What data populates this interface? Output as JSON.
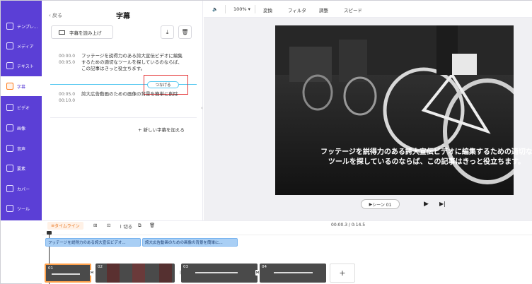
{
  "sidebar": {
    "items": [
      {
        "label": "テンプレ..."
      },
      {
        "label": "メディア"
      },
      {
        "label": "テキスト"
      },
      {
        "label": "字幕"
      },
      {
        "label": "ビデオ"
      },
      {
        "label": "画像"
      },
      {
        "label": "音声"
      },
      {
        "label": "要素"
      },
      {
        "label": "カバー"
      },
      {
        "label": "ツール"
      }
    ],
    "active_index": 3,
    "bg_color": "#5b3fd6"
  },
  "panel": {
    "back_label": "戻る",
    "title": "字幕",
    "read_button": "字幕を読み上げ",
    "subtitles": [
      {
        "start": "00:00.0",
        "end": "00:05.0",
        "text": "フッテージを説得力のある誇大宣伝ビデオに編集するための適切なツールを探しているのならば、この記事はきっと役立ちます。"
      },
      {
        "start": "00:05.0",
        "end": "00:10.0",
        "text": "誇大広告動画のための画像の背景を簡単に削除"
      }
    ],
    "join_label": "つなげる",
    "add_subtitle": "新しい字幕を加える"
  },
  "toolbar": {
    "zoom": "100%",
    "items": [
      "変換",
      "フィルタ",
      "調整",
      "スピード"
    ]
  },
  "preview": {
    "caption": "フッテージを説得力のある誇大宣伝ビデオに編集するための適切なツールを探しているのならば、この記事はきっと役立ちます。",
    "scene_label": "シーン 01"
  },
  "timeline": {
    "label": "タイムライン",
    "split_label": "切る",
    "time": "00:00.3 / 0:14.5",
    "subtitle_clips": [
      "フッテージを説得力のある誇大宣伝ビデオ...",
      "誇大広告動画のための画像の背景を簡単に..."
    ],
    "clips": [
      "01",
      "02",
      "03",
      "04"
    ]
  },
  "colors": {
    "accent": "#ff7a1a",
    "brand": "#5b3fd6",
    "highlight": "#e5383b",
    "subtitle_clip": "#a9cff5"
  }
}
